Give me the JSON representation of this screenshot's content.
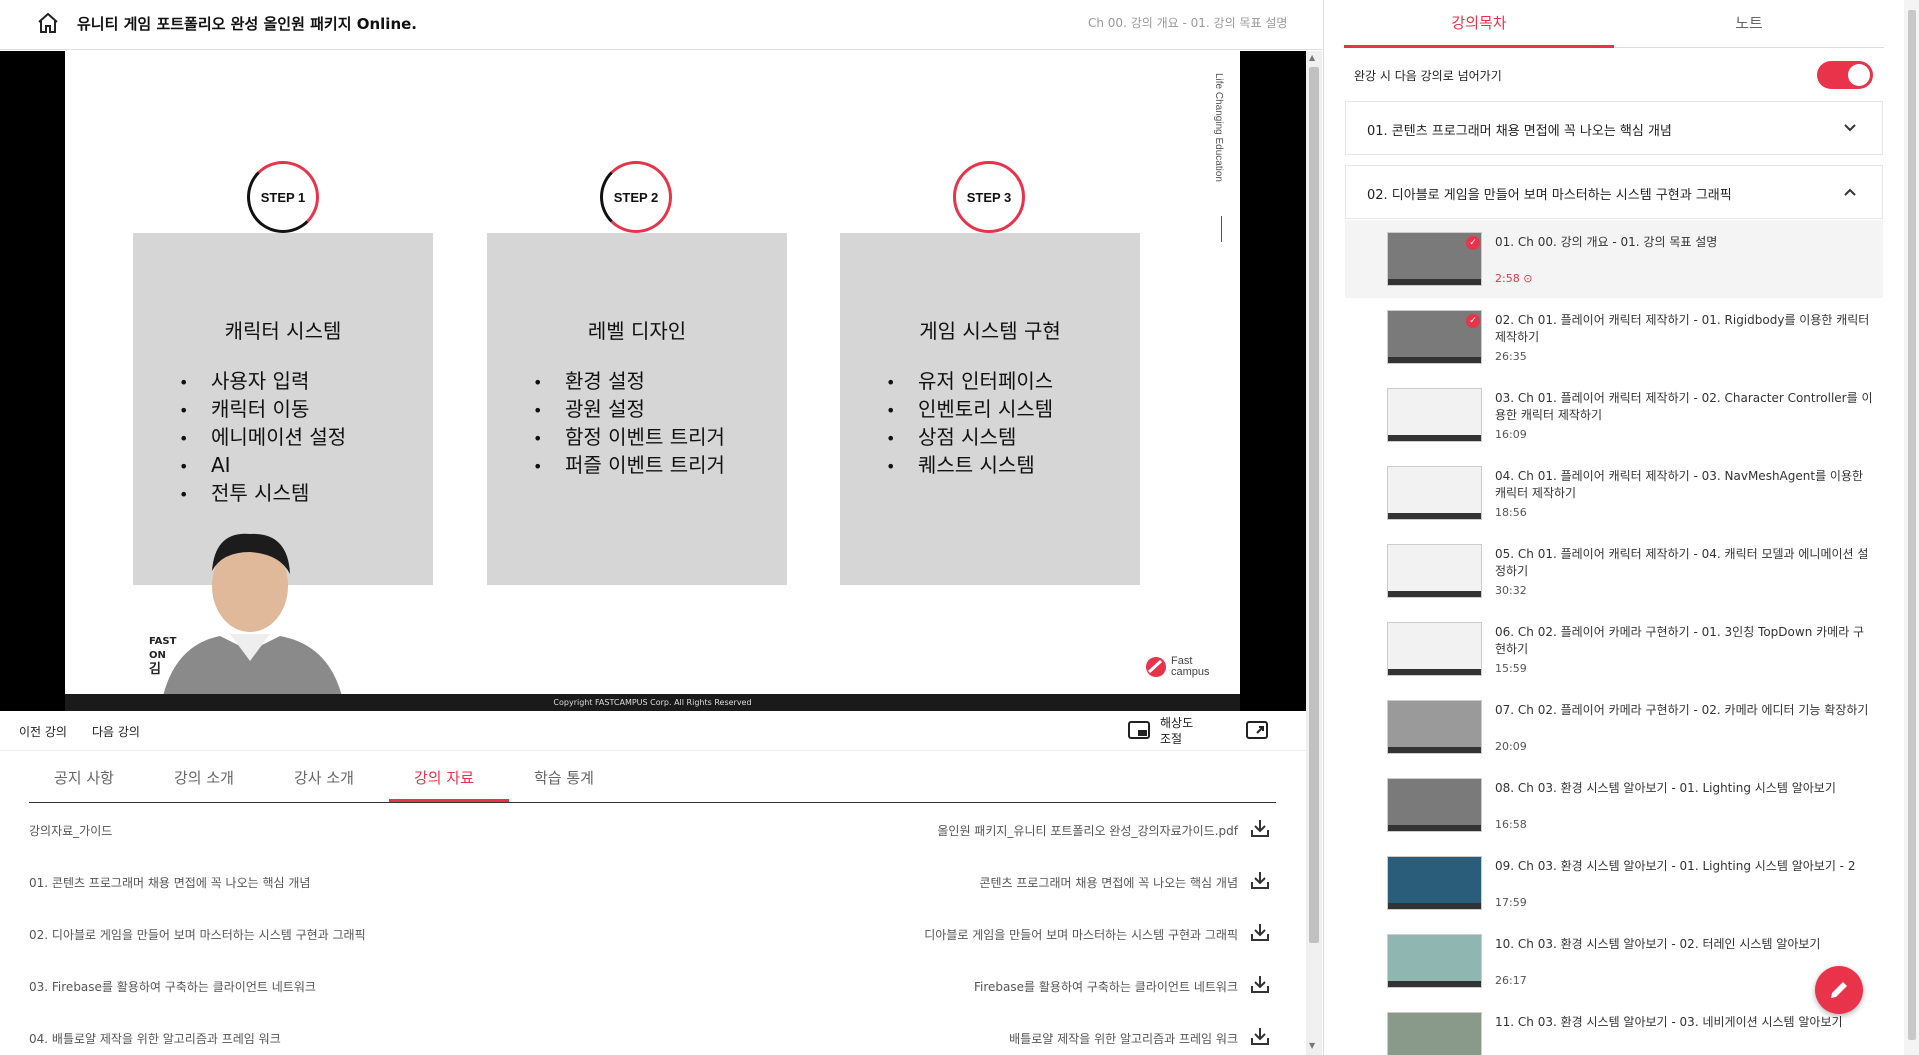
{
  "header": {
    "course_title": "유니티 게임 포트폴리오 완성 올인원 패키지 Online.",
    "breadcrumb": "Ch 00. 강의 개요 - 01. 강의 목표 설명"
  },
  "slide": {
    "side_text": "Life Changing Education",
    "copyright": "Copyright FASTCAMPUS Corp. All Rights Reserved",
    "brand_line1": "FAST",
    "brand_line2": "ON",
    "brand_line3": "김",
    "logo_line1": "Fast",
    "logo_line2": "campus",
    "steps": [
      {
        "badge": "STEP 1",
        "title": "캐릭터 시스템",
        "items": [
          "사용자 입력",
          "캐릭터 이동",
          "에니메이션 설정",
          "AI",
          "전투 시스템"
        ]
      },
      {
        "badge": "STEP 2",
        "title": "레벨 디자인",
        "items": [
          "환경 설정",
          "광원 설정",
          "함정 이벤트 트리거",
          "퍼즐 이벤트 트리거"
        ]
      },
      {
        "badge": "STEP 3",
        "title": "게임 시스템 구현",
        "items": [
          "유저 인터페이스",
          "인벤토리 시스템",
          "상점 시스템",
          "퀘스트 시스템"
        ]
      }
    ]
  },
  "controls": {
    "prev": "이전 강의",
    "next": "다음 강의",
    "resolution_line1": "해상도",
    "resolution_line2": "조절"
  },
  "tabs": [
    {
      "label": "공지 사항"
    },
    {
      "label": "강의 소개"
    },
    {
      "label": "강사 소개"
    },
    {
      "label": "강의 자료",
      "active": true
    },
    {
      "label": "학습 통계"
    }
  ],
  "materials": [
    {
      "name": "강의자료_가이드",
      "file": "올인원 패키지_유니티 포트폴리오 완성_강의자료가이드.pdf"
    },
    {
      "name": "01. 콘텐츠 프로그래머 채용 면접에 꼭 나오는 핵심 개념",
      "file": "콘텐츠 프로그래머 채용 면접에 꼭 나오는 핵심 개념"
    },
    {
      "name": "02. 디아블로 게임을 만들어 보며 마스터하는 시스템 구현과 그래픽",
      "file": "디아블로 게임을 만들어 보며 마스터하는 시스템 구현과 그래픽"
    },
    {
      "name": "03. Firebase를 활용하여 구축하는 클라이언트 네트워크",
      "file": "Firebase를 활용하여 구축하는 클라이언트 네트워크"
    },
    {
      "name": "04. 배틀로얄 제작을 위한 알고리즘과 프레임 워크",
      "file": "배틀로얄 제작을 위한 알고리즘과 프레임 워크"
    }
  ],
  "panel": {
    "tab_toc": "강의목차",
    "tab_notes": "노트",
    "autoplay_label": "완강 시 다음 강의로 넘어가기",
    "autoplay_on": true,
    "sections": [
      {
        "title": "01. 콘텐츠 프로그래머 채용 면접에 꼭 나오는 핵심 개념",
        "expanded": false
      },
      {
        "title": "02. 디아블로 게임을 만들어 보며 마스터하는 시스템 구현과 그래픽",
        "expanded": true
      }
    ],
    "lectures": [
      {
        "title": "01. Ch 00. 강의 개요 - 01. 강의 목표 설명",
        "time": "2:58",
        "current": true,
        "done": true,
        "thumb": "red"
      },
      {
        "title": "02. Ch 01. 플레이어 캐릭터 제작하기 - 01. Rigidbody를 이용한 캐릭터 제작하기",
        "time": "26:35",
        "done": true,
        "thumb": "red"
      },
      {
        "title": "03. Ch 01. 플레이어 캐릭터 제작하기 - 02. Character Controller를 이용한 캐릭터 제작하기",
        "time": "16:09",
        "thumb": "white"
      },
      {
        "title": "04. Ch 01. 플레이어 캐릭터 제작하기 - 03. NavMeshAgent를 이용한 캐릭터 제작하기",
        "time": "18:56",
        "thumb": "white"
      },
      {
        "title": "05. Ch 01. 플레이어 캐릭터 제작하기 - 04. 캐릭터 모델과 에니메이션 설정하기",
        "time": "30:32",
        "thumb": "white"
      },
      {
        "title": "06. Ch 02. 플레이어 카메라 구현하기 - 01. 3인칭 TopDown 카메라 구현하기",
        "time": "15:59",
        "thumb": "white"
      },
      {
        "title": "07. Ch 02. 플레이어 카메라 구현하기 - 02. 카메라 에디터 기능 확장하기",
        "time": "20:09",
        "thumb": "editor"
      },
      {
        "title": "08. Ch 03. 환경 시스템 알아보기 - 01. Lighting 시스템 알아보기",
        "time": "16:58",
        "thumb": "red"
      },
      {
        "title": "09. Ch 03. 환경 시스템 알아보기 - 01. Lighting 시스템 알아보기 - 2",
        "time": "17:59",
        "thumb": "probes"
      },
      {
        "title": "10. Ch 03. 환경 시스템 알아보기 - 02. 터레인 시스템 알아보기",
        "time": "26:17",
        "thumb": "terrain"
      },
      {
        "title": "11. Ch 03. 환경 시스템 알아보기 - 03. 네비게이션 시스템 알아보기",
        "time": "",
        "thumb": "editor"
      }
    ]
  },
  "colors": {
    "accent": "#e8334a"
  }
}
